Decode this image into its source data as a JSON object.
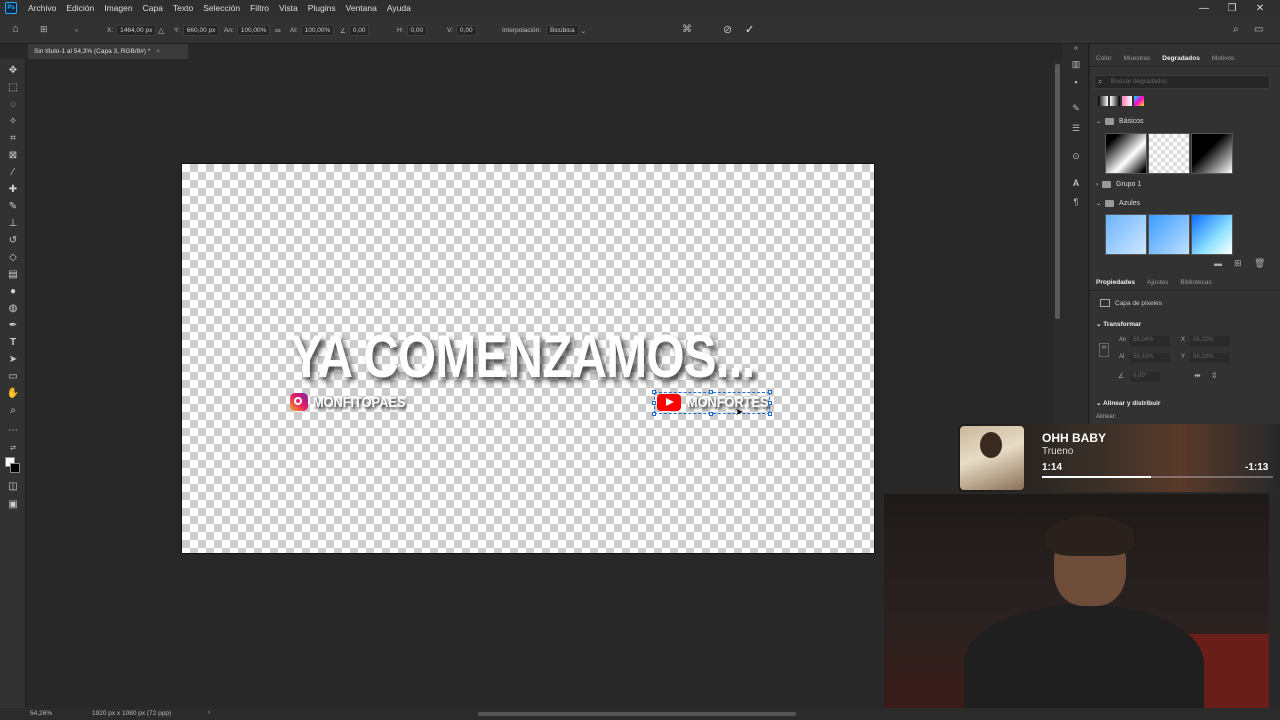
{
  "menubar": {
    "logo": "Ps",
    "items": [
      "Archivo",
      "Edición",
      "Imagen",
      "Capa",
      "Texto",
      "Selección",
      "Filtro",
      "Vista",
      "Plugins",
      "Ventana",
      "Ayuda"
    ],
    "window_controls": [
      "—",
      "❐",
      "✕"
    ]
  },
  "options": {
    "x_label": "X:",
    "x_value": "1464,00 px",
    "y_label": "Y:",
    "y_value": "660,00 px",
    "w_label": "An:",
    "w_value": "100,00%",
    "h_label": "Al:",
    "h_value": "100,00%",
    "angle_value": "0,00",
    "hskew_label": "H:",
    "hskew_value": "0,00",
    "vskew_label": "V:",
    "vskew_value": "0,00",
    "interp_label": "Interpolación:",
    "interp_value": "Bicúbica"
  },
  "document": {
    "tab_title": "Sin título-1 al 54,3% (Capa 3, RGB/8#) *",
    "tab_close": "×",
    "headline": "YA COMENZAMOS...",
    "instagram_handle": "MONFITOPAES",
    "youtube_handle": "MONFORTES"
  },
  "status": {
    "zoom": "54,26%",
    "doc_info": "1920 px x 1080 px (72 ppp)"
  },
  "gradients_panel": {
    "tabs": [
      "Color",
      "Muestras",
      "Degradados",
      "Motivos"
    ],
    "active_tab": "Degradados",
    "search_placeholder": "Buscar degradados",
    "folders": [
      "Básicos",
      "Grupo 1",
      "Azules"
    ]
  },
  "properties_panel": {
    "tabs": [
      "Propiedades",
      "Ajustes",
      "Bibliotecas"
    ],
    "active_tab": "Propiedades",
    "layer_type": "Capa de píxeles",
    "transform_title": "Transformar",
    "w_label": "An",
    "w_value": "56,04%",
    "x_label": "X",
    "x_value": "56,22%",
    "h_label": "Al",
    "h_value": "56,33%",
    "y_label": "Y",
    "y_value": "56,33%",
    "angle_value": "0,00°",
    "align_title": "Alinear y distribuir",
    "align_label": "Alinear:"
  },
  "music": {
    "title": "OHH BABY",
    "artist": "Trueno",
    "elapsed": "1:14",
    "remaining": "-1:13",
    "progress": 0.47
  }
}
